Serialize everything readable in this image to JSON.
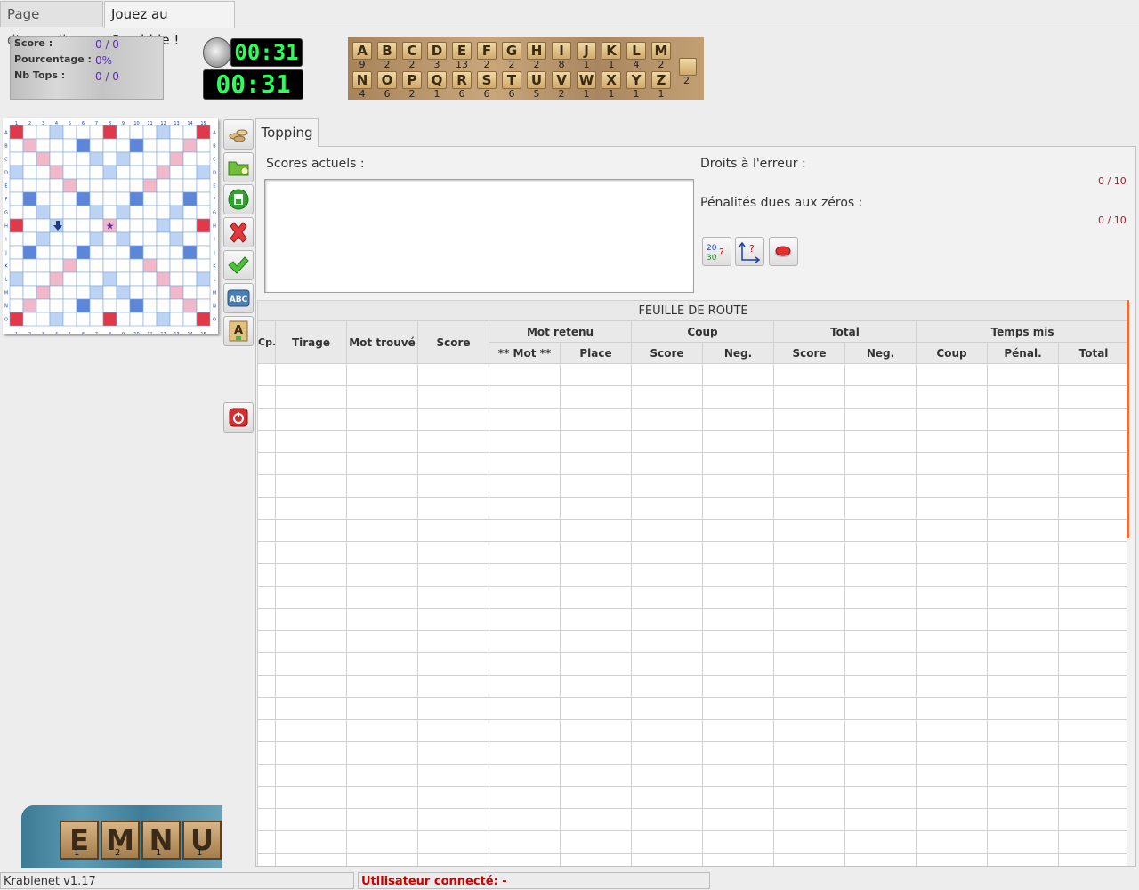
{
  "tabs": [
    "Page d'accueil",
    "Jouez au Scrabble !"
  ],
  "score_panel": {
    "rows": [
      {
        "label": "Score :",
        "value": "0 / 0"
      },
      {
        "label": "Pourcentage :",
        "value": "0%"
      },
      {
        "label": "Nb Tops :",
        "value": "0 / 0"
      }
    ]
  },
  "timers": {
    "small": "00:31",
    "large": "00:31"
  },
  "bag": {
    "row1": [
      {
        "l": "A",
        "c": "9"
      },
      {
        "l": "B",
        "c": "2"
      },
      {
        "l": "C",
        "c": "2"
      },
      {
        "l": "D",
        "c": "3"
      },
      {
        "l": "E",
        "c": "13"
      },
      {
        "l": "F",
        "c": "2"
      },
      {
        "l": "G",
        "c": "2"
      },
      {
        "l": "H",
        "c": "2"
      },
      {
        "l": "I",
        "c": "8"
      },
      {
        "l": "J",
        "c": "1"
      },
      {
        "l": "K",
        "c": "1"
      },
      {
        "l": "L",
        "c": "4"
      },
      {
        "l": "M",
        "c": "2"
      }
    ],
    "row2": [
      {
        "l": "N",
        "c": "4"
      },
      {
        "l": "O",
        "c": "6"
      },
      {
        "l": "P",
        "c": "2"
      },
      {
        "l": "Q",
        "c": "1"
      },
      {
        "l": "R",
        "c": "6"
      },
      {
        "l": "S",
        "c": "6"
      },
      {
        "l": "T",
        "c": "6"
      },
      {
        "l": "U",
        "c": "5"
      },
      {
        "l": "V",
        "c": "2"
      },
      {
        "l": "W",
        "c": "1"
      },
      {
        "l": "X",
        "c": "1"
      },
      {
        "l": "Y",
        "c": "1"
      },
      {
        "l": "Z",
        "c": "1"
      }
    ],
    "joker_count": "2"
  },
  "board": {
    "cols": [
      "1",
      "2",
      "3",
      "4",
      "5",
      "6",
      "7",
      "8",
      "9",
      "10",
      "11",
      "12",
      "13",
      "14",
      "15"
    ],
    "rows": [
      "A",
      "B",
      "C",
      "D",
      "E",
      "F",
      "G",
      "H",
      "I",
      "J",
      "K",
      "L",
      "M",
      "N",
      "O"
    ]
  },
  "toolbar": [
    "tiles-icon",
    "open-folder-icon",
    "save-icon",
    "cancel-icon",
    "validate-icon",
    "abc-icon",
    "letter-a-icon",
    "power-icon"
  ],
  "topping": {
    "tab_label": "Topping",
    "scores_label": "Scores actuels :",
    "droits_label": "Droits à l'erreur :",
    "droits_value": "0 / 10",
    "penal_label": "Pénalités dues aux zéros :",
    "penal_value": "0 / 10"
  },
  "route": {
    "title": "FEUILLE DE ROUTE",
    "groups": [
      "Mot retenu",
      "Coup",
      "Total",
      "Temps mis"
    ],
    "cols_single": [
      "Cp.",
      "Tirage",
      "Mot trouvé",
      "Score"
    ],
    "sub": [
      "** Mot **",
      "Place",
      "Score",
      "Neg.",
      "Score",
      "Neg.",
      "Coup",
      "Pénal.",
      "Total"
    ]
  },
  "logo_tiles": [
    {
      "l": "E",
      "v": "1"
    },
    {
      "l": "M",
      "v": "2"
    },
    {
      "l": "N",
      "v": "1"
    },
    {
      "l": "U",
      "v": "1"
    }
  ],
  "status": {
    "version": "Krablenet v1.17",
    "user": "Utilisateur connecté:  -"
  },
  "colors": {
    "lcd_green": "#2cff5a",
    "score_value": "#5b2bb5",
    "status_red": "#cc0000",
    "accent_scroll": "#e87040"
  }
}
